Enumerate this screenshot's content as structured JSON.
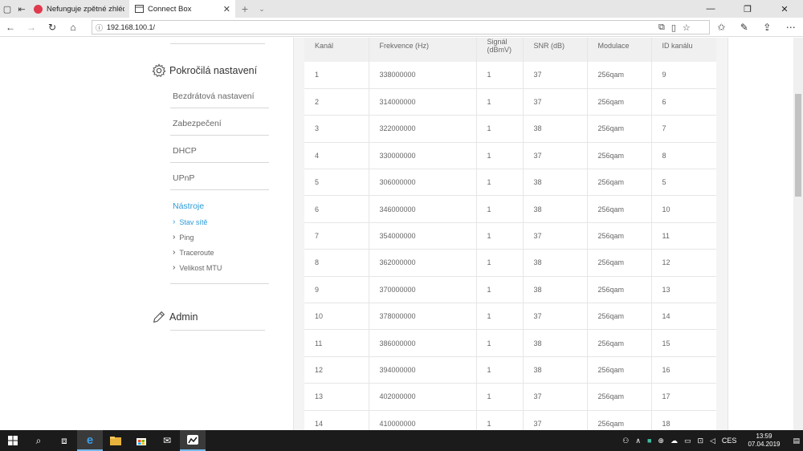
{
  "browser": {
    "tabs": [
      {
        "title": "Nefunguje zpětné zhlédnutí",
        "active": false
      },
      {
        "title": "Connect Box",
        "active": true
      }
    ],
    "address": "192.168.100.1/"
  },
  "sidebar": {
    "advanced_title": "Pokročilá nastavení",
    "items": [
      {
        "label": "Bezdrátová nastavení"
      },
      {
        "label": "Zabezpečení"
      },
      {
        "label": "DHCP"
      },
      {
        "label": "UPnP"
      }
    ],
    "tools": {
      "label": "Nástroje",
      "subitems": [
        {
          "label": "Stav sítě",
          "active": true
        },
        {
          "label": "Ping",
          "active": false
        },
        {
          "label": "Traceroute",
          "active": false
        },
        {
          "label": "Velikost MTU",
          "active": false
        }
      ]
    },
    "admin_title": "Admin"
  },
  "table": {
    "headers": [
      "Kanál",
      "Frekvence (Hz)",
      "Signál (dBmV)",
      "SNR (dB)",
      "Modulace",
      "ID kanálu"
    ],
    "rows": [
      [
        "1",
        "338000000",
        "1",
        "37",
        "256qam",
        "9"
      ],
      [
        "2",
        "314000000",
        "1",
        "37",
        "256qam",
        "6"
      ],
      [
        "3",
        "322000000",
        "1",
        "38",
        "256qam",
        "7"
      ],
      [
        "4",
        "330000000",
        "1",
        "37",
        "256qam",
        "8"
      ],
      [
        "5",
        "306000000",
        "1",
        "38",
        "256qam",
        "5"
      ],
      [
        "6",
        "346000000",
        "1",
        "38",
        "256qam",
        "10"
      ],
      [
        "7",
        "354000000",
        "1",
        "37",
        "256qam",
        "11"
      ],
      [
        "8",
        "362000000",
        "1",
        "38",
        "256qam",
        "12"
      ],
      [
        "9",
        "370000000",
        "1",
        "38",
        "256qam",
        "13"
      ],
      [
        "10",
        "378000000",
        "1",
        "37",
        "256qam",
        "14"
      ],
      [
        "11",
        "386000000",
        "1",
        "38",
        "256qam",
        "15"
      ],
      [
        "12",
        "394000000",
        "1",
        "38",
        "256qam",
        "16"
      ],
      [
        "13",
        "402000000",
        "1",
        "37",
        "256qam",
        "17"
      ],
      [
        "14",
        "410000000",
        "1",
        "37",
        "256qam",
        "18"
      ]
    ]
  },
  "taskbar": {
    "language": "CES",
    "time": "13:59",
    "date": "07.04.2019"
  },
  "colors": {
    "accent": "#2b9ad6",
    "taskbar": "#1b1b1b"
  }
}
